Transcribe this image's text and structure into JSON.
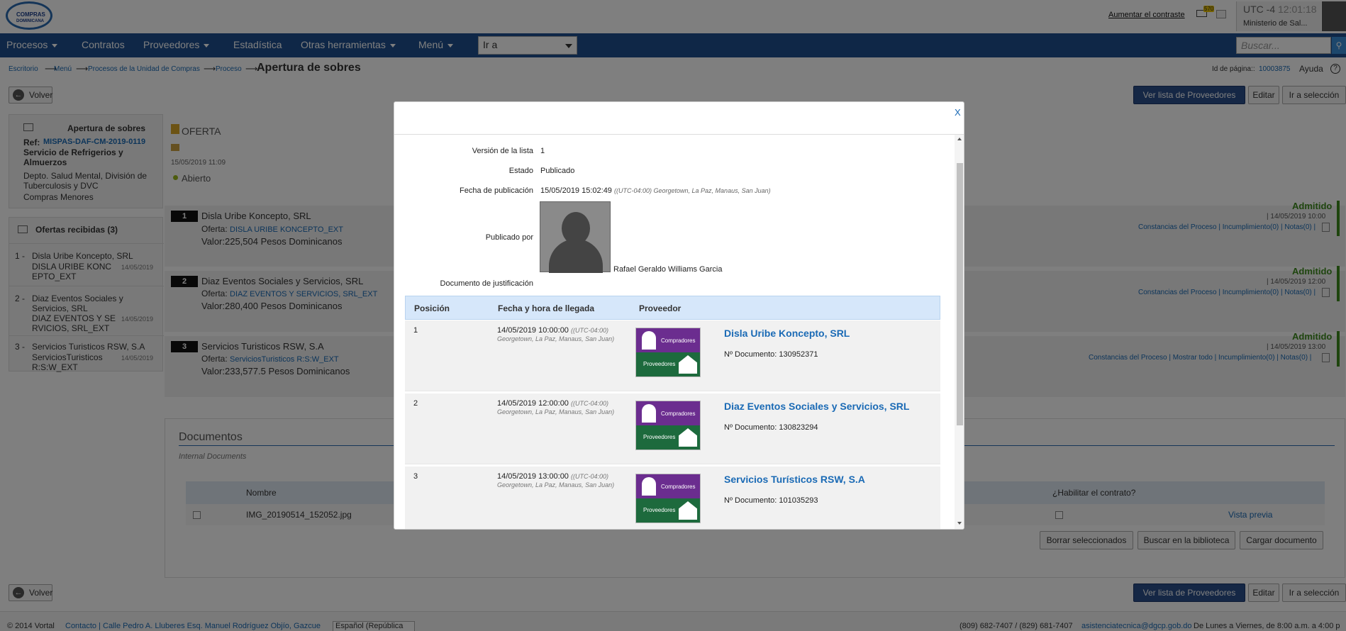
{
  "header": {
    "logo_text_1": "COMPRAS",
    "logo_text_2": "DOMINICANA",
    "contrast_link": "Aumentar el contraste",
    "mail_count": "570",
    "timezone": "UTC -4",
    "clock": "12:01:18",
    "ministry": "Ministerio de Sal..."
  },
  "nav": {
    "items": [
      "Procesos",
      "Contratos",
      "Proveedores",
      "Estadística",
      "Otras herramientas",
      "Menú"
    ],
    "goto_label": "Ir a",
    "search_placeholder": "Buscar..."
  },
  "breadcrumb": {
    "items": [
      "Escritorio",
      "Menú",
      "Procesos de la Unidad de Compras",
      "Proceso"
    ],
    "current": "Apertura de sobres"
  },
  "page": {
    "id_label": "Id de página::",
    "id_value": "10003875",
    "help": "Ayuda",
    "back": "Volver",
    "btn_list": "Ver lista de Proveedores",
    "btn_edit": "Editar",
    "btn_select": "Ir a selección"
  },
  "left_panel": {
    "title": "Apertura de sobres",
    "ref_label": "Ref:",
    "ref": "MISPAS-DAF-CM-2019-0119",
    "desc": "Servicio de Refrigerios y Almuerzos",
    "dept": "Depto. Salud Mental, División de Tuberculosis y DVC",
    "type": "Compras Menores",
    "offers_title": "Ofertas recibidas (3)",
    "offers": [
      {
        "n": "1 -",
        "name": "Disla Uribe Koncepto, SRL",
        "code": "DISLA URIBE KONC EPTO_EXT",
        "date": "14/05/2019"
      },
      {
        "n": "2 -",
        "name": "Diaz Eventos Sociales y Servicios, SRL",
        "code": "DIAZ EVENTOS Y SE RVICIOS, SRL_EXT",
        "date": "14/05/2019"
      },
      {
        "n": "3 -",
        "name": "Servicios Turisticos RSW, S.A",
        "code": "ServiciosTuristicos R:S:W_EXT",
        "date": "14/05/2019"
      }
    ]
  },
  "main": {
    "oferta_title": "OFERTA",
    "oferta_date": "15/05/2019 11:09",
    "status": "Abierto",
    "offer_label": "Oferta:",
    "proposals": [
      {
        "n": "1",
        "name": "Disla Uribe Koncepto, SRL",
        "offer": "DISLA URIBE KONCEPTO_EXT",
        "value": "Valor:225,504 Pesos Dominicanos",
        "status": "Admitido",
        "date": "| 14/05/2019 10:00",
        "links": "Constancias del Proceso  |  Incumplimiento(0)  |  Notas(0)  |"
      },
      {
        "n": "2",
        "name": "Diaz Eventos Sociales y Servicios, SRL",
        "offer": "DIAZ EVENTOS Y SERVICIOS, SRL_EXT",
        "value": "Valor:280,400 Pesos Dominicanos",
        "status": "Admitido",
        "date": "| 14/05/2019 12:00",
        "links": "Constancias del Proceso  |  Incumplimiento(0)  |  Notas(0)  |"
      },
      {
        "n": "3",
        "name": "Servicios Turisticos RSW, S.A",
        "offer": "ServiciosTuristicos R:S:W_EXT",
        "value": "Valor:233,577.5 Pesos Dominicanos",
        "status": "Admitido",
        "date": "| 14/05/2019 13:00",
        "links": "Constancias del Proceso  |  Mostrar todo  |  Incumplimiento(0)  |  Notas(0)  |"
      }
    ],
    "docs_title": "Documentos",
    "docs_sub": "Internal Documents",
    "docs_col_name": "Nombre",
    "docs_col_enable": "¿Habilitar el contrato?",
    "doc_file": "IMG_20190514_152052.jpg",
    "doc_preview": "Vista previa",
    "btn_delete": "Borrar seleccionados",
    "btn_search_lib": "Buscar en la biblioteca",
    "btn_upload": "Cargar documento"
  },
  "footer": {
    "copyright": "© 2014 Vortal",
    "contact": "Contacto | Calle Pedro A. Lluberes Esq. Manuel Rodríguez Objío, Gazcue",
    "lang": "Español (República",
    "phones": "(809) 682-7407 / (829) 681-7407",
    "email": "asistenciatecnica@dgcp.gob.do",
    "hours": "De Lunes a Viernes, de 8:00 a.m. a 4:00 p"
  },
  "modal": {
    "close": "X",
    "version_label": "Versión de la lista",
    "version": "1",
    "state_label": "Estado",
    "state": "Publicado",
    "pubdate_label": "Fecha de publicación",
    "pubdate": "15/05/2019 15:02:49",
    "pubdate_tz": "((UTC-04:00) Georgetown, La Paz, Manaus, San Juan)",
    "publisher_label": "Publicado por",
    "publisher": "Rafael Geraldo Williams Garcia",
    "justif_label": "Documento de justificación",
    "col_pos": "Posición",
    "col_date": "Fecha y hora de llegada",
    "col_prov": "Proveedor",
    "badge_top": "Compradores",
    "badge_bot": "Proveedores",
    "doc_label": "Nº Documento:",
    "rows": [
      {
        "pos": "1",
        "date": "14/05/2019 10:00:00",
        "tz": "((UTC-04:00)",
        "city": "Georgetown, La Paz, Manaus, San Juan)",
        "name": "Disla Uribe Koncepto, SRL",
        "doc": "130952371"
      },
      {
        "pos": "2",
        "date": "14/05/2019 12:00:00",
        "tz": "((UTC-04:00)",
        "city": "Georgetown, La Paz, Manaus, San Juan)",
        "name": "Diaz Eventos Sociales y Servicios, SRL",
        "doc": "130823294"
      },
      {
        "pos": "3",
        "date": "14/05/2019 13:00:00",
        "tz": "((UTC-04:00)",
        "city": "Georgetown, La Paz, Manaus, San Juan)",
        "name": "Servicios Turísticos RSW, S.A",
        "doc": "101035293"
      }
    ]
  }
}
